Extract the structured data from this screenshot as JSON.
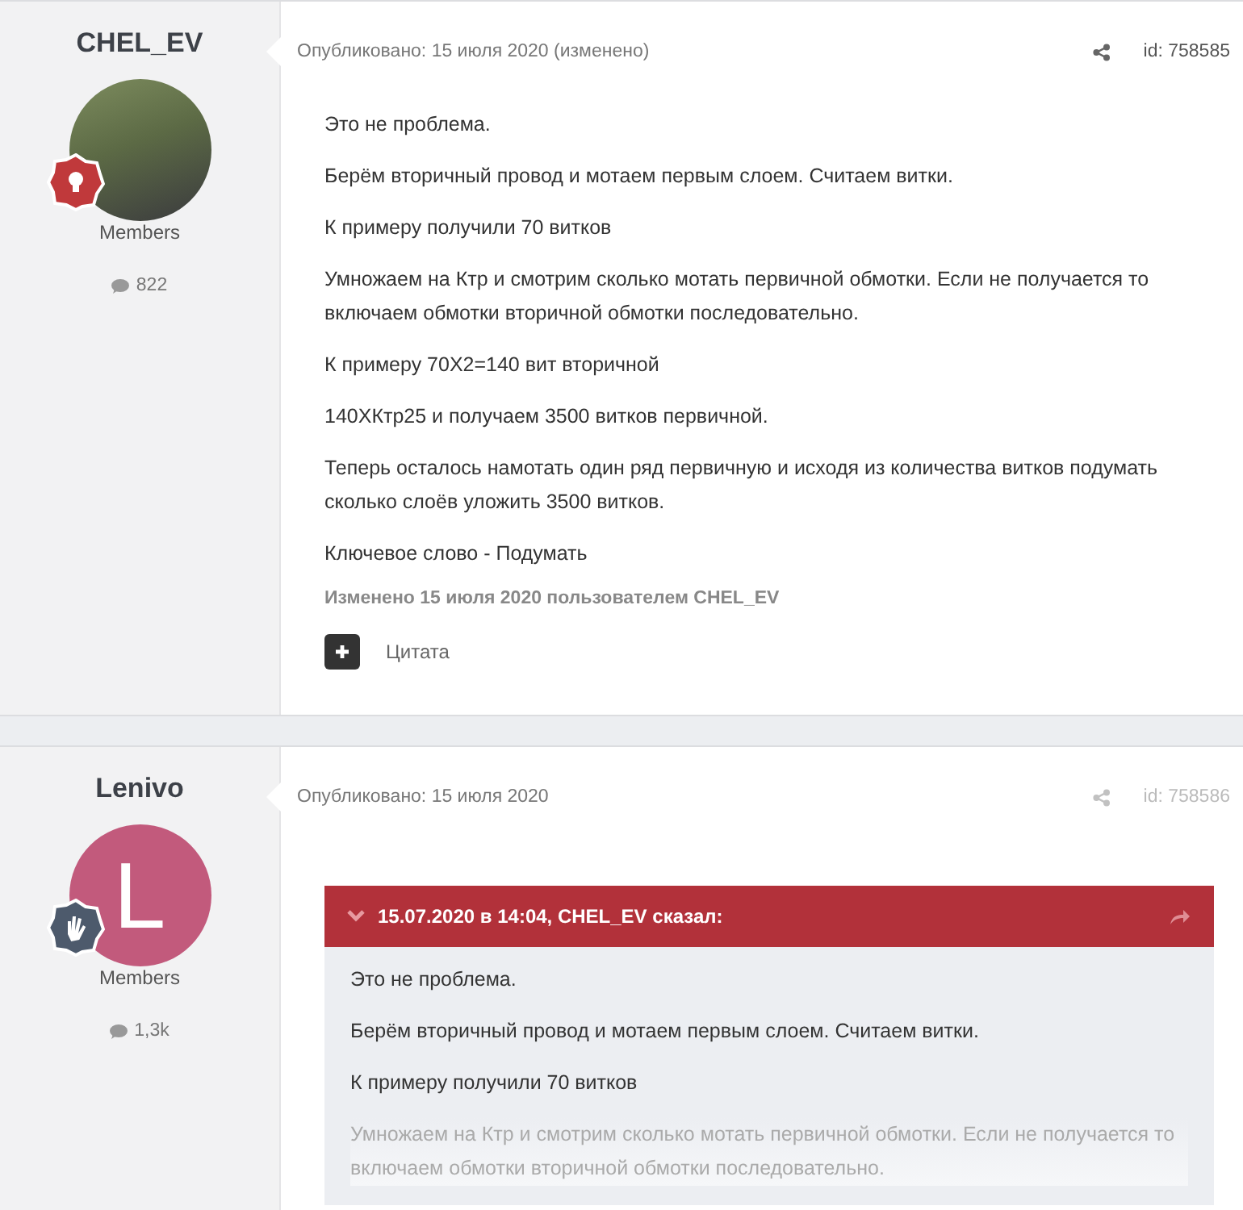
{
  "posts": [
    {
      "author": {
        "name": "CHEL_EV",
        "avatar": {
          "kind": "photo"
        },
        "badge": {
          "kind": "bulb",
          "color": "#c0393b"
        },
        "group": "Members",
        "post_count": "822"
      },
      "published": "Опубликовано: 15 июля 2020 (изменено)",
      "post_id": "id: 758585",
      "id_dimmed": false,
      "body": [
        {
          "kind": "text",
          "text": "Это не проблема."
        },
        {
          "kind": "text",
          "text": "Берём вторичный провод и мотаем первым слоем. Считаем витки."
        },
        {
          "kind": "text",
          "text": "К примеру получили 70 витков"
        },
        {
          "kind": "text",
          "text": "Умножаем на Ктр и смотрим сколько мотать первичной обмотки. Если не получается то включаем обмотки вторичной обмотки последовательно."
        },
        {
          "kind": "text",
          "text": "К примеру 70Х2=140 вит вторичной"
        },
        {
          "kind": "text",
          "text": "140ХКтр25 и получаем 3500 витков первичной."
        },
        {
          "kind": "text",
          "text": "Теперь осталось намотать один ряд первичную и исходя из количества витков подумать сколько слоёв уложить 3500 витков."
        },
        {
          "kind": "text",
          "text": "Ключевое слово - Подумать"
        }
      ],
      "edited_note": "Изменено 15 июля 2020 пользователем CHEL_EV",
      "quote_button": "Цитата"
    },
    {
      "author": {
        "name": "Lenivo",
        "avatar": {
          "kind": "letter",
          "letter": "L",
          "color": "#c25a7c"
        },
        "badge": {
          "kind": "hand",
          "color": "#4d5a6c"
        },
        "group": "Members",
        "post_count": "1,3k"
      },
      "published": "Опубликовано: 15 июля 2020",
      "post_id": "id: 758586",
      "id_dimmed": true,
      "body": [
        {
          "kind": "quote",
          "header": "15.07.2020 в 14:04, CHEL_EV сказал:",
          "collapsed": true,
          "paragraphs": [
            "Это не проблема.",
            "Берём вторичный провод и мотаем первым слоем. Считаем витки.",
            "К примеру получили 70 витков",
            "Умножаем на Ктр и смотрим сколько мотать первичной обмотки. Если не получается то включаем обмотки вторичной обмотки последовательно."
          ]
        }
      ]
    }
  ]
}
